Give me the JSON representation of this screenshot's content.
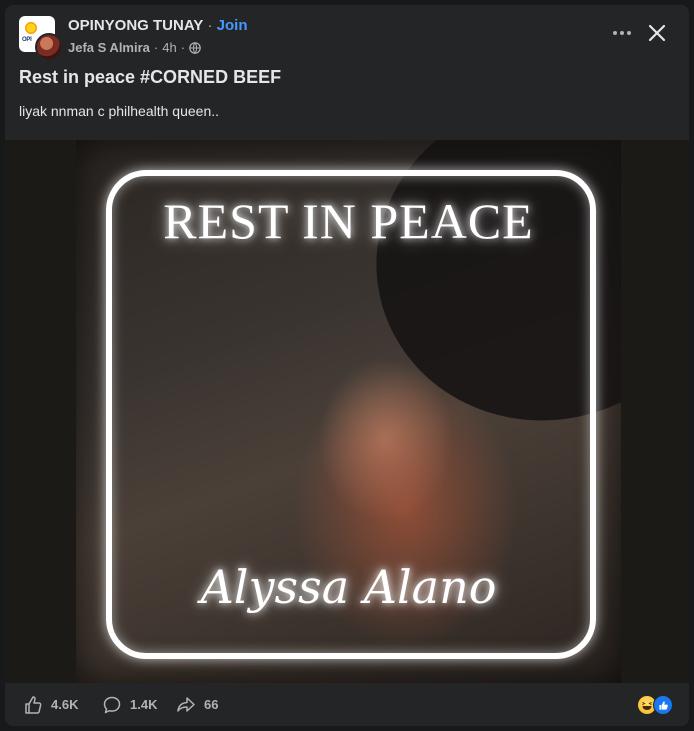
{
  "post": {
    "group_name": "OPINYONG TUNAY",
    "separator": " · ",
    "join_label": "Join",
    "author": "Jefa S Almira",
    "time": "4h",
    "title": "Rest in peace #CORNED BEEF",
    "body": "liyak nnman c philhealth queen.."
  },
  "image": {
    "headline": "REST IN PEACE",
    "name_script": "Alyssa Alano"
  },
  "footer": {
    "like_count": "4.6K",
    "comment_count": "1.4K",
    "share_count": "66"
  },
  "icons": {
    "more": "more-options-icon",
    "close": "close-icon",
    "audience": "globe-icon",
    "like": "thumbs-up-icon",
    "comment": "comment-bubble-icon",
    "share": "share-arrow-icon",
    "reaction_haha": "haha-reaction-icon",
    "reaction_like": "like-reaction-icon"
  },
  "colors": {
    "background": "#18191a",
    "card": "#242526",
    "accent": "#4599ff",
    "text_primary": "#e4e6eb",
    "text_secondary": "#b0b3b8"
  }
}
